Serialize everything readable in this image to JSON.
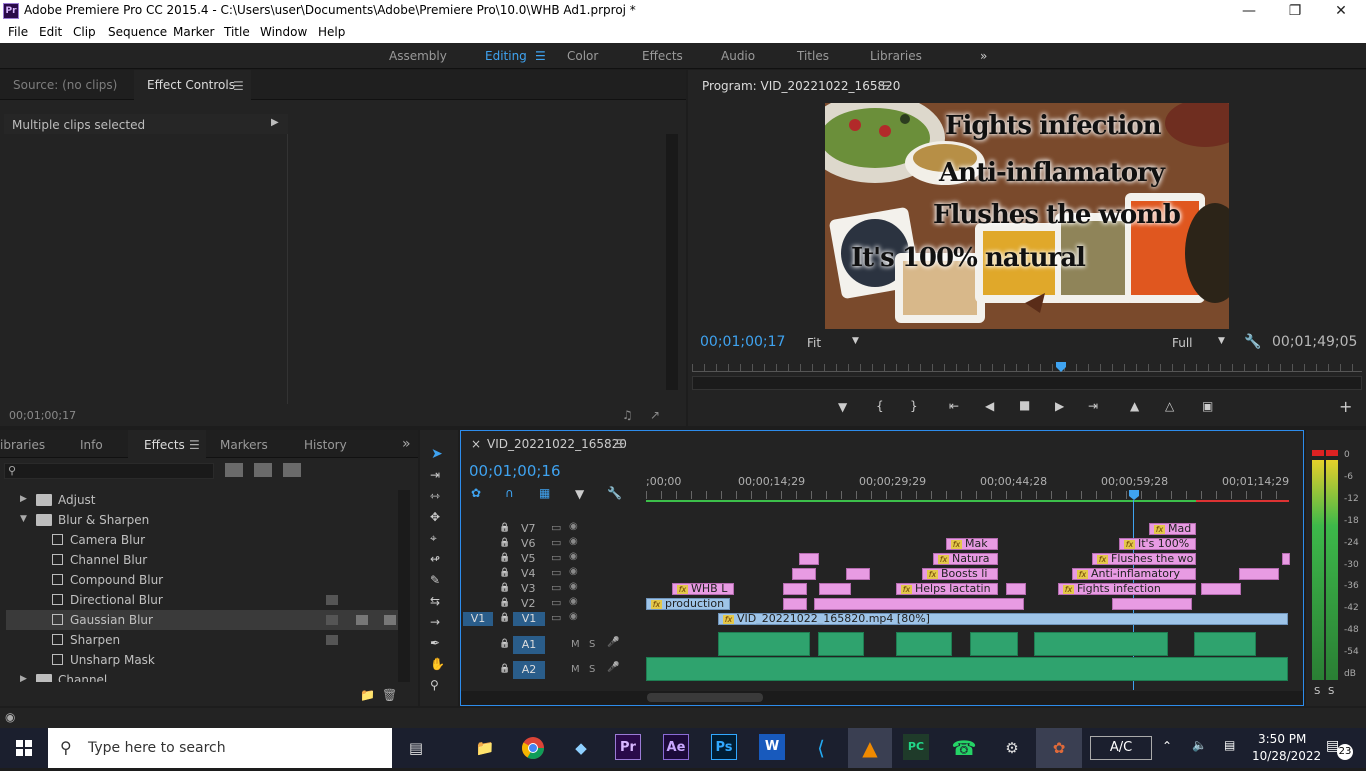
{
  "window": {
    "title": "Adobe Premiere Pro CC 2015.4 - C:\\Users\\user\\Documents\\Adobe\\Premiere Pro\\10.0\\WHB Ad1.prproj *",
    "app_icon": "Pr"
  },
  "menu": [
    "File",
    "Edit",
    "Clip",
    "Sequence",
    "Marker",
    "Title",
    "Window",
    "Help"
  ],
  "workspaces": [
    "Assembly",
    "Editing",
    "Color",
    "Effects",
    "Audio",
    "Titles",
    "Libraries"
  ],
  "source_panel": {
    "tab_source": "Source: (no clips)",
    "tab_effect_controls": "Effect Controls",
    "selection_label": "Multiple clips selected",
    "timecode": "00;01;00;17"
  },
  "program_panel": {
    "title": "Program: VID_20221022_165820",
    "overlay_lines": [
      "Fights infection",
      "Anti-inflamatory",
      "Flushes the womb",
      "It's 100% natural"
    ],
    "timecode": "00;01;00;17",
    "fit": "Fit",
    "quality": "Full",
    "duration": "00;01;49;05"
  },
  "effects_panel": {
    "tabs": [
      "ibraries",
      "Info",
      "Effects",
      "Markers",
      "History"
    ],
    "items": [
      {
        "label": "Adjust",
        "type": "folder"
      },
      {
        "label": "Blur & Sharpen",
        "type": "folder-open"
      },
      {
        "label": "Camera Blur",
        "type": "effect"
      },
      {
        "label": "Channel Blur",
        "type": "effect"
      },
      {
        "label": "Compound Blur",
        "type": "effect"
      },
      {
        "label": "Directional Blur",
        "type": "effect"
      },
      {
        "label": "Gaussian Blur",
        "type": "effect"
      },
      {
        "label": "Sharpen",
        "type": "effect"
      },
      {
        "label": "Unsharp Mask",
        "type": "effect"
      },
      {
        "label": "Channel",
        "type": "folder"
      }
    ]
  },
  "timeline": {
    "sequence_name": "VID_20221022_165820",
    "timecode": "00;01;00;16",
    "ruler": [
      ";00;00",
      "00;00;14;29",
      "00;00;29;29",
      "00;00;44;28",
      "00;00;59;28",
      "00;01;14;29"
    ],
    "video_tracks": [
      "V7",
      "V6",
      "V5",
      "V4",
      "V3",
      "V2",
      "V1"
    ],
    "audio_tracks": [
      "A1",
      "A2"
    ],
    "source_patch": "V1",
    "clips": {
      "v7": "Mad",
      "v6_a": "Mak",
      "v6_b": "It's 100%",
      "v5_a": "Natura",
      "v5_b": "Flushes the wo",
      "v4_a": "Boosts li",
      "v4_b": "Anti-inflamatory",
      "v3_a": "WHB L",
      "v3_b": "Helps lactatin",
      "v3_c": "Fights infection",
      "v2_a": "production",
      "v1": "VID_20221022_165820.mp4 [80%]"
    }
  },
  "audio_meter": {
    "scale": [
      "0",
      "-6",
      "-12",
      "-18",
      "-24",
      "-30",
      "-36",
      "-42",
      "-48",
      "-54",
      "dB"
    ],
    "solo": [
      "S",
      "S"
    ]
  },
  "taskbar": {
    "search_placeholder": "Type here to search",
    "time": "3:50 PM",
    "date": "10/28/2022",
    "notifications": "23",
    "ac_label": "A/C"
  }
}
